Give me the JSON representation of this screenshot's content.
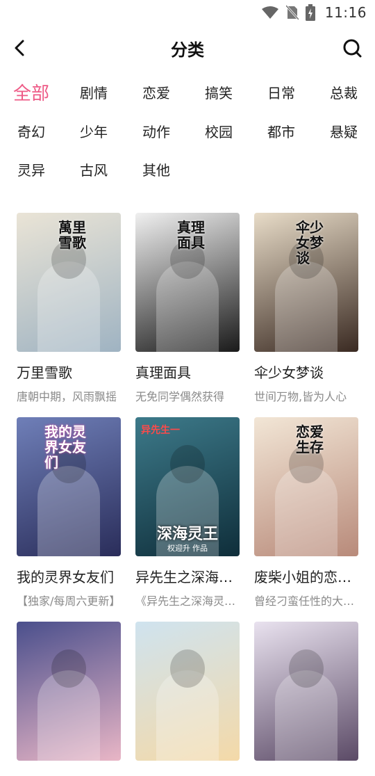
{
  "status": {
    "time": "11:16",
    "icons": [
      "wifi-icon",
      "no-sim-icon",
      "battery-charging-icon"
    ]
  },
  "header": {
    "title": "分类",
    "back_icon": "chevron-left-icon",
    "search_icon": "search-icon"
  },
  "categories": {
    "active_color": "#ee5a86",
    "items": [
      {
        "label": "全部",
        "active": true
      },
      {
        "label": "剧情"
      },
      {
        "label": "恋爱"
      },
      {
        "label": "搞笑"
      },
      {
        "label": "日常"
      },
      {
        "label": "总裁"
      },
      {
        "label": "奇幻"
      },
      {
        "label": "少年"
      },
      {
        "label": "动作"
      },
      {
        "label": "校园"
      },
      {
        "label": "都市"
      },
      {
        "label": "悬疑"
      },
      {
        "label": "灵异"
      },
      {
        "label": "古风"
      },
      {
        "label": "其他"
      }
    ]
  },
  "comics": [
    {
      "title": "万里雪歌",
      "desc": "唐朝中期，风雨飘摇",
      "cover_text": "萬里雪歌",
      "colors": [
        "#eae4d6",
        "#9fb3c2"
      ]
    },
    {
      "title": "真理面具",
      "desc": "无免同学偶然获得",
      "cover_text": "真理面具",
      "colors": [
        "#f0f0f0",
        "#1a1a1a"
      ]
    },
    {
      "title": "伞少女梦谈",
      "desc": "世间万物,皆为人心",
      "cover_text": "伞少女梦谈",
      "colors": [
        "#e8dcc8",
        "#3a2a22"
      ]
    },
    {
      "title": "我的灵界女友们",
      "desc": "【独家/每周六更新】",
      "cover_text": "我的灵界女友们",
      "colors": [
        "#6f7fb8",
        "#2a2d5a"
      ]
    },
    {
      "title": "异先生之深海灵王",
      "desc": "《异先生之深海灵王》",
      "cover_text": "深海灵王",
      "cover_top": "异先生一",
      "cover_author": "权迎升 作品",
      "colors": [
        "#3d7a8a",
        "#0f2e3a"
      ]
    },
    {
      "title": "废柴小姐的恋爱生存",
      "desc": "曾经刁蛮任性的大小姐",
      "cover_text": "恋爱生存",
      "colors": [
        "#f2e6d6",
        "#b88a7a"
      ]
    },
    {
      "title": "",
      "desc": "",
      "colors": [
        "#4a4f8c",
        "#e9b6c6"
      ]
    },
    {
      "title": "",
      "desc": "",
      "colors": [
        "#cfe3ef",
        "#f4d9a8"
      ]
    },
    {
      "title": "",
      "desc": "",
      "colors": [
        "#e9e2ef",
        "#5b4a66"
      ]
    }
  ]
}
